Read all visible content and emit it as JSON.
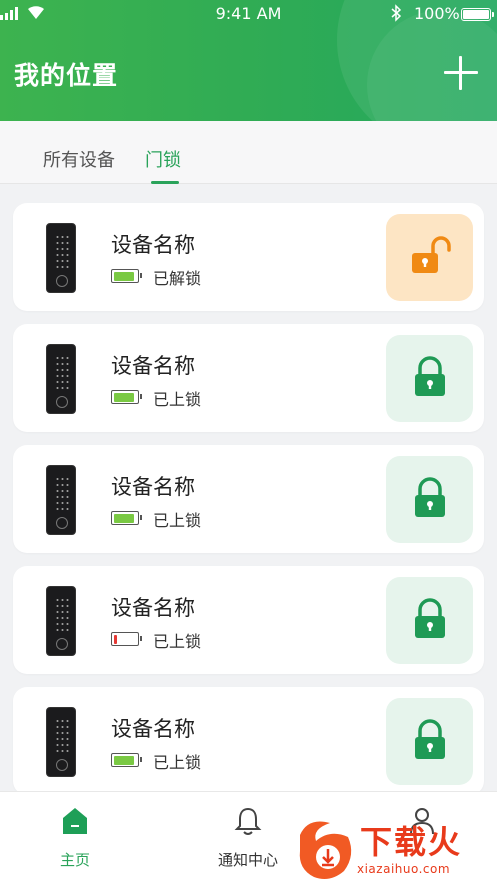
{
  "status_bar": {
    "time": "9:41 AM",
    "battery_pct": "100%",
    "icons": [
      "signal-icon",
      "wifi-icon",
      "bluetooth-icon",
      "battery-icon"
    ]
  },
  "header": {
    "title": "我的位置",
    "add_icon": "plus-icon"
  },
  "tabs": [
    {
      "label": "所有设备",
      "active": false
    },
    {
      "label": "门锁",
      "active": true
    }
  ],
  "colors": {
    "accent": "#2aa35a",
    "unlocked_bg": "#fde5c4",
    "unlocked_fg": "#f08a14",
    "locked_bg": "#e6f4ec",
    "locked_fg": "#1f9a55",
    "battery_full": "#7ac943",
    "battery_low": "#e53935"
  },
  "devices": [
    {
      "name": "设备名称",
      "status": "已解锁",
      "locked": false,
      "battery_level": 0.9
    },
    {
      "name": "设备名称",
      "status": "已上锁",
      "locked": true,
      "battery_level": 0.9
    },
    {
      "name": "设备名称",
      "status": "已上锁",
      "locked": true,
      "battery_level": 0.9
    },
    {
      "name": "设备名称",
      "status": "已上锁",
      "locked": true,
      "battery_level": 0.15
    },
    {
      "name": "设备名称",
      "status": "已上锁",
      "locked": true,
      "battery_level": 0.9
    }
  ],
  "bottom_nav": [
    {
      "label": "主页",
      "icon": "home-icon",
      "active": true
    },
    {
      "label": "通知中心",
      "icon": "bell-icon",
      "active": false
    },
    {
      "label": "",
      "icon": "user-icon",
      "active": false
    }
  ],
  "watermark": {
    "text": "下载火",
    "sub": "xiazaihuo.com"
  }
}
